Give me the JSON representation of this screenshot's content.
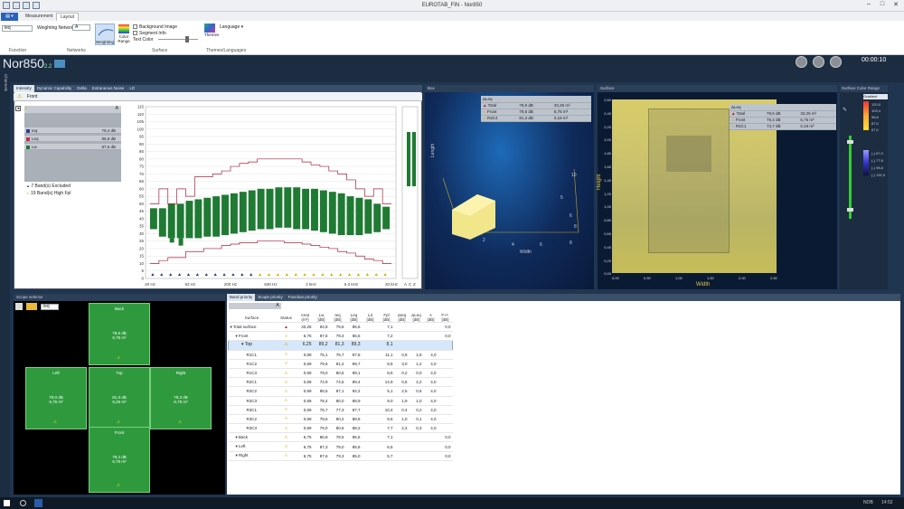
{
  "window": {
    "title": "EUROTAB_FIN - Nor850",
    "controls": [
      "–",
      "□",
      "✕"
    ]
  },
  "ribbon": {
    "file_tab": "",
    "tabs": [
      "Measurement",
      "Layout"
    ],
    "function_value": "leq",
    "weighting_label": "Weighting Network",
    "weighting_value": "A",
    "btn_weighting": "Weighting",
    "btn_color_range": "Color Range",
    "chk_background": "Background Image",
    "chk_segment": "Segment Info",
    "text_color": "Text Color",
    "btn_themes": "Themes",
    "btn_language": "Language",
    "groups": [
      "Function",
      "Networks",
      "Surface",
      "Themes/Languages"
    ]
  },
  "app": {
    "logo": "Nor850",
    "logo_suffix": "2.2",
    "timer": "00:00:10",
    "left_strip": "Channels"
  },
  "spectrum": {
    "tabs": [
      "Intensity",
      "Dynamic Capability",
      "Delta",
      "Extraneous Noise",
      "LD"
    ],
    "header": "Front",
    "legend": [
      {
        "label": "Ieq",
        "value": "79,4 dB",
        "color": "#2e3f8a"
      },
      {
        "label": "Leq",
        "value": "86,5 dB",
        "color": "#c0304a"
      },
      {
        "label": "Lw",
        "value": "87,6 dB",
        "color": "#1f7a33"
      }
    ],
    "notes": [
      "7 Band(s) Excluded",
      "19 Band(s) High Fpl"
    ],
    "yticks": [
      "115",
      "110",
      "105",
      "100",
      "95",
      "90",
      "85",
      "80",
      "75",
      "70",
      "65",
      "60",
      "55",
      "50",
      "45",
      "40",
      "35",
      "30",
      "25",
      "20",
      "15",
      "10",
      "5",
      "0"
    ],
    "xticks": [
      "20 Hz",
      "63 Hz",
      "200 Hz",
      "630 Hz",
      "2 kHz",
      "6.3 kHz",
      "20 kHz"
    ],
    "x_right": [
      "A",
      "C",
      "Z"
    ]
  },
  "chart_data": {
    "type": "bar",
    "title": "",
    "ylim": [
      0,
      115
    ],
    "bar_series": [
      47,
      47,
      50,
      50,
      52,
      53,
      54,
      55,
      56,
      57,
      58,
      59,
      60,
      60,
      61,
      61,
      61,
      60,
      60,
      59,
      58,
      57,
      55,
      54,
      53,
      50,
      48
    ],
    "bar_base": [
      33,
      28,
      27,
      27,
      27,
      27,
      28,
      28,
      29,
      30,
      31,
      32,
      33,
      33,
      34,
      34,
      33,
      33,
      32,
      31,
      30,
      29,
      29,
      29,
      30,
      31,
      33
    ],
    "neg_series": [
      40,
      28,
      24,
      22,
      28,
      30,
      32,
      34,
      36,
      38,
      38,
      38,
      36,
      36,
      38,
      40,
      40,
      40,
      41,
      42,
      43,
      42,
      41,
      40,
      39,
      38,
      37
    ],
    "upper_line": [
      50,
      60,
      50,
      60,
      55,
      68,
      68,
      70,
      72,
      75,
      77,
      78,
      80,
      80,
      80,
      80,
      80,
      78,
      76,
      75,
      72,
      70,
      66,
      60,
      55,
      60,
      50
    ],
    "lower_line": [
      10,
      12,
      14,
      14,
      18,
      18,
      20,
      20,
      22,
      23,
      24,
      24,
      25,
      25,
      25,
      24,
      24,
      23,
      22,
      21,
      20,
      18,
      17,
      15,
      13,
      12,
      10
    ]
  },
  "view3d": {
    "title": "Box",
    "table": [
      [
        "ΔLeq",
        "",
        ""
      ],
      [
        "Total",
        "79,6 dB",
        "33,25 m²"
      ],
      [
        "Front",
        "79,6 dB",
        "6,75 m²"
      ],
      [
        "R3C4",
        "81,3 dB",
        "0,19 m²"
      ]
    ],
    "axis_labels": [
      "Length",
      "Width"
    ],
    "ticks": [
      "10",
      "5",
      "6",
      "8",
      "2",
      "4",
      "6",
      "8"
    ]
  },
  "surface": {
    "title": "Surface",
    "table": [
      [
        "ΔLeq",
        "",
        ""
      ],
      [
        "Total",
        "79,6 dB",
        "33,25 m²"
      ],
      [
        "Front",
        "79,4 dB",
        "6,75 m²"
      ],
      [
        "R4C1",
        "74,7 dB",
        "0,19 m²"
      ]
    ],
    "yticks": [
      "2,60",
      "2,40",
      "2,20",
      "2,00",
      "1,80",
      "1,60",
      "1,40",
      "1,20",
      "1,00",
      "0,80",
      "0,60",
      "0,40",
      "0,20",
      "0,00"
    ],
    "xticks": [
      "0,00",
      "0,50",
      "1,00",
      "1,50",
      "2,00",
      "2,50"
    ],
    "xlabel": "Width",
    "ylabel": "Height"
  },
  "colorrange": {
    "title": "Surface Color Range",
    "palette": "Gradient Palette",
    "values": [
      "120,0",
      "109,4",
      "98,8",
      "87,0",
      "67,0"
    ],
    "low_values": [
      "(-) 67,0",
      "(-) 77,6",
      "(-) 98,8",
      "(-) 120,0"
    ]
  },
  "scope": {
    "title": "Scope selector",
    "select": "leq",
    "faces": [
      {
        "name": "Back",
        "db": "78,5 dB",
        "area": "6,75 m²"
      },
      {
        "name": "Left",
        "db": "79,0 dB",
        "area": "6,75 m²"
      },
      {
        "name": "Top",
        "db": "81,3 dB",
        "area": "6,25 m²"
      },
      {
        "name": "Right",
        "db": "79,3 dB",
        "area": "6,75 m²"
      },
      {
        "name": "Front",
        "db": "79,4 dB",
        "area": "6,75 m²"
      }
    ]
  },
  "band_table": {
    "tabs": [
      "Band priority",
      "Scope priority",
      "Function priority"
    ],
    "headers": [
      "Surface",
      "Status",
      "Area\n(m²)",
      "Lw\n[dB]",
      "Ieq\n[dB]",
      "Leq\n[dB]",
      "Ld\n[dB]",
      "Fpl\n[dB]",
      "ΔIeq\n[dB]",
      "ΔLeq\n[dB]",
      "s\n[dB]",
      "F+/-\n[dB]"
    ],
    "rows": [
      [
        "Total surface",
        "err",
        "33,25",
        "94,8",
        "79,6",
        "86,6",
        "",
        "7,1",
        "",
        "",
        "",
        "0,0"
      ],
      [
        "Front",
        "warn",
        "6,75",
        "87,6",
        "79,4",
        "86,5",
        "",
        "7,2",
        "",
        "",
        "",
        "0,0"
      ],
      [
        "Top",
        "warn",
        "6,25",
        "89,2",
        "81,3",
        "89,3",
        "",
        "8,1",
        "",
        "",
        "",
        ""
      ],
      [
        "R1C1",
        "warn",
        "0,69",
        "75,1",
        "76,7",
        "87,8",
        "",
        "11,1",
        "0,9",
        "1,8",
        "4,0",
        ""
      ],
      [
        "R1C2",
        "warn",
        "0,69",
        "79,6",
        "81,2",
        "89,7",
        "",
        "8,5",
        "3,0",
        "1,2",
        "4,0",
        ""
      ],
      [
        "R1C3",
        "warn",
        "0,69",
        "79,0",
        "80,6",
        "89,1",
        "",
        "8,5",
        "0,2",
        "0,0",
        "4,0",
        ""
      ],
      [
        "R2C1",
        "warn",
        "0,69",
        "72,9",
        "74,5",
        "89,4",
        "",
        "14,9",
        "0,5",
        "2,2",
        "4,0",
        ""
      ],
      [
        "R2C2",
        "warn",
        "0,69",
        "85,5",
        "87,1",
        "92,2",
        "",
        "5,1",
        "2,5",
        "0,6",
        "4,0",
        ""
      ],
      [
        "R2C3",
        "warn",
        "0,69",
        "78,4",
        "80,0",
        "88,9",
        "",
        "9,0",
        "1,9",
        "1,0",
        "4,0",
        ""
      ],
      [
        "R3C1",
        "warn",
        "0,69",
        "75,7",
        "77,3",
        "87,7",
        "",
        "10,4",
        "0,4",
        "0,2",
        "4,0",
        ""
      ],
      [
        "R3C2",
        "warn",
        "0,69",
        "78,6",
        "80,2",
        "88,8",
        "",
        "8,6",
        "1,0",
        "0,1",
        "4,0",
        ""
      ],
      [
        "R3C3",
        "warn",
        "0,69",
        "79,0",
        "80,5",
        "88,2",
        "",
        "7,7",
        "2,2",
        "0,3",
        "4,0",
        ""
      ],
      [
        "Back",
        "warn",
        "6,75",
        "86,8",
        "78,5",
        "85,6",
        "",
        "7,1",
        "",
        "",
        "",
        "0,0"
      ],
      [
        "Left",
        "warn",
        "6,75",
        "87,3",
        "79,0",
        "85,6",
        "",
        "6,5",
        "",
        "",
        "",
        "0,0"
      ],
      [
        "Right",
        "warn",
        "6,75",
        "87,6",
        "79,3",
        "85,0",
        "",
        "5,7",
        "",
        "",
        "",
        "0,0"
      ]
    ]
  },
  "taskbar": {
    "lang": "NOB",
    "time": "14:52"
  }
}
